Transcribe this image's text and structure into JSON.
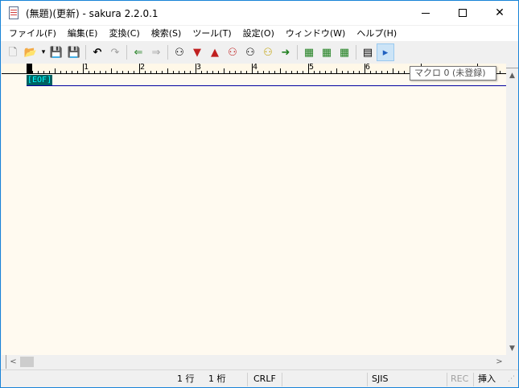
{
  "window": {
    "title": "(無題)(更新) - sakura 2.2.0.1",
    "close_glyph": "✕"
  },
  "menu": [
    {
      "label": "ファイル(F)"
    },
    {
      "label": "編集(E)"
    },
    {
      "label": "変換(C)"
    },
    {
      "label": "検索(S)"
    },
    {
      "label": "ツール(T)"
    },
    {
      "label": "設定(O)"
    },
    {
      "label": "ウィンドウ(W)"
    },
    {
      "label": "ヘルプ(H)"
    }
  ],
  "toolbar": {
    "buttons": [
      {
        "icon": "new-file-icon",
        "glyph": "🗋"
      },
      {
        "icon": "open-folder-icon",
        "glyph": "📂"
      },
      {
        "icon": "dropdown-arrow-icon",
        "glyph": "▾"
      },
      {
        "icon": "save-icon",
        "glyph": "💾"
      },
      {
        "icon": "save-as-icon",
        "glyph": "💾"
      },
      {
        "icon": "undo-icon",
        "glyph": "↶"
      },
      {
        "icon": "redo-icon",
        "glyph": "↷"
      },
      {
        "icon": "back-icon",
        "glyph": "⇐"
      },
      {
        "icon": "forward-icon",
        "glyph": "⇒"
      },
      {
        "icon": "search-icon",
        "glyph": "⚇"
      },
      {
        "icon": "search-next-icon",
        "glyph": "▼"
      },
      {
        "icon": "search-prev-icon",
        "glyph": "▲"
      },
      {
        "icon": "mark-search-icon",
        "glyph": "⚇"
      },
      {
        "icon": "clear-mark-icon",
        "glyph": "⚇"
      },
      {
        "icon": "grep-icon",
        "glyph": "⚇"
      },
      {
        "icon": "jump-icon",
        "glyph": "➜"
      },
      {
        "icon": "outline-icon",
        "glyph": "▦"
      },
      {
        "icon": "font-icon",
        "glyph": "▦"
      },
      {
        "icon": "settings-icon",
        "glyph": "▦"
      },
      {
        "icon": "properties-icon",
        "glyph": "▤"
      },
      {
        "icon": "macro-run-icon",
        "glyph": "▸"
      }
    ]
  },
  "ruler": {
    "labels": [
      "1",
      "2",
      "3",
      "4",
      "5",
      "6"
    ]
  },
  "editor": {
    "eof_marker": "[EOF]"
  },
  "tooltip": {
    "text": "マクロ 0 (未登録)"
  },
  "scrollbar": {
    "up_glyph": "▲",
    "down_glyph": "▼",
    "left_glyph": "<",
    "right_glyph": ">"
  },
  "status": {
    "row": "1 行",
    "col": "1 桁",
    "line_ending": "CRLF",
    "encoding": "SJIS",
    "rec": "REC",
    "insert_mode": "挿入"
  },
  "colors": {
    "window_border": "#1883d7",
    "editor_bg": "#fffaf0",
    "eof_bg": "#006060",
    "eof_fg": "#00ffff",
    "cursor_line": "#0000a0"
  }
}
